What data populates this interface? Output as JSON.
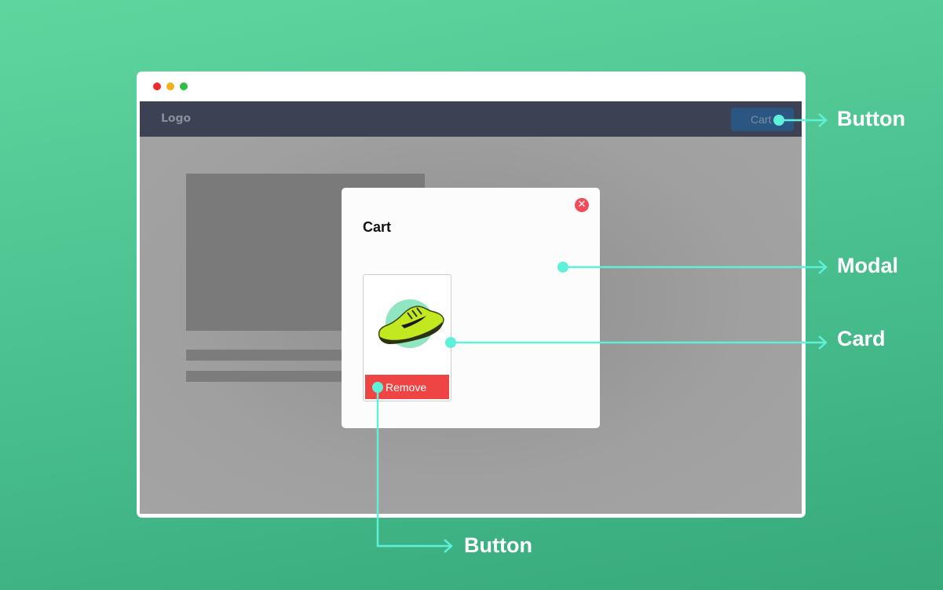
{
  "browser": {
    "navbar": {
      "logo": "Logo",
      "cart_button": "Cart"
    }
  },
  "modal": {
    "title": "Cart",
    "close_icon": "close-icon",
    "card": {
      "product_icon": "sneaker-icon",
      "remove_button": "Remove"
    }
  },
  "annotations": [
    {
      "label": "Button"
    },
    {
      "label": "Modal"
    },
    {
      "label": "Card"
    },
    {
      "label": "Button"
    }
  ],
  "colors": {
    "background": "#4cc291",
    "annotation_line": "#5ef0d8",
    "navbar": "#3c4153",
    "cart_button": "#2b5682",
    "remove_button": "#ef4444",
    "close_button": "#f04e5a"
  }
}
